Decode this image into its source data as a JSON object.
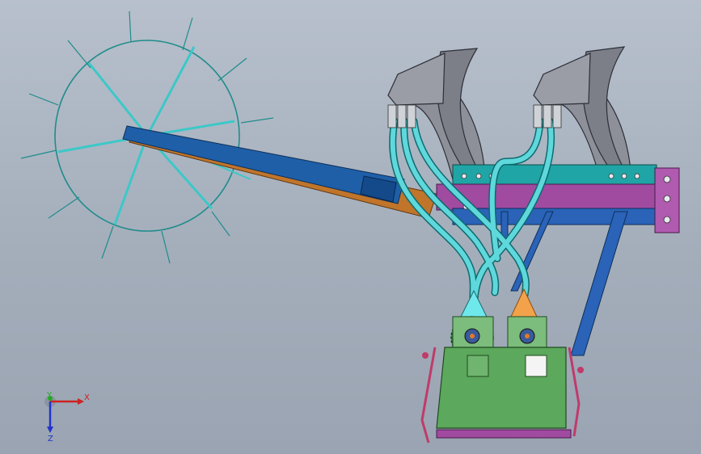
{
  "viewport": {
    "background_top": "#b7c0cc",
    "background_bottom": "#9aa4b2"
  },
  "triad": {
    "x_label": "X",
    "y_label": "Y",
    "z_label": "Z",
    "x_color": "#cc2222",
    "y_color": "#22aa22",
    "z_color": "#2233cc"
  },
  "colors": {
    "wheel": "#1f8c8c",
    "wheel_spokes": "#3cc8c8",
    "arm_orange": "#c0752a",
    "arm_blue": "#1e5fa8",
    "frame_teal": "#1fa5a5",
    "frame_magenta": "#a04aa0",
    "frame_blue": "#2a63b8",
    "shank_gray": "#8d8f99",
    "tube_cyan": "#5fd8dc",
    "hopper_green": "#5ca85c",
    "funnel_cyan": "#6fe8ec",
    "funnel_orange": "#f2a24a"
  }
}
